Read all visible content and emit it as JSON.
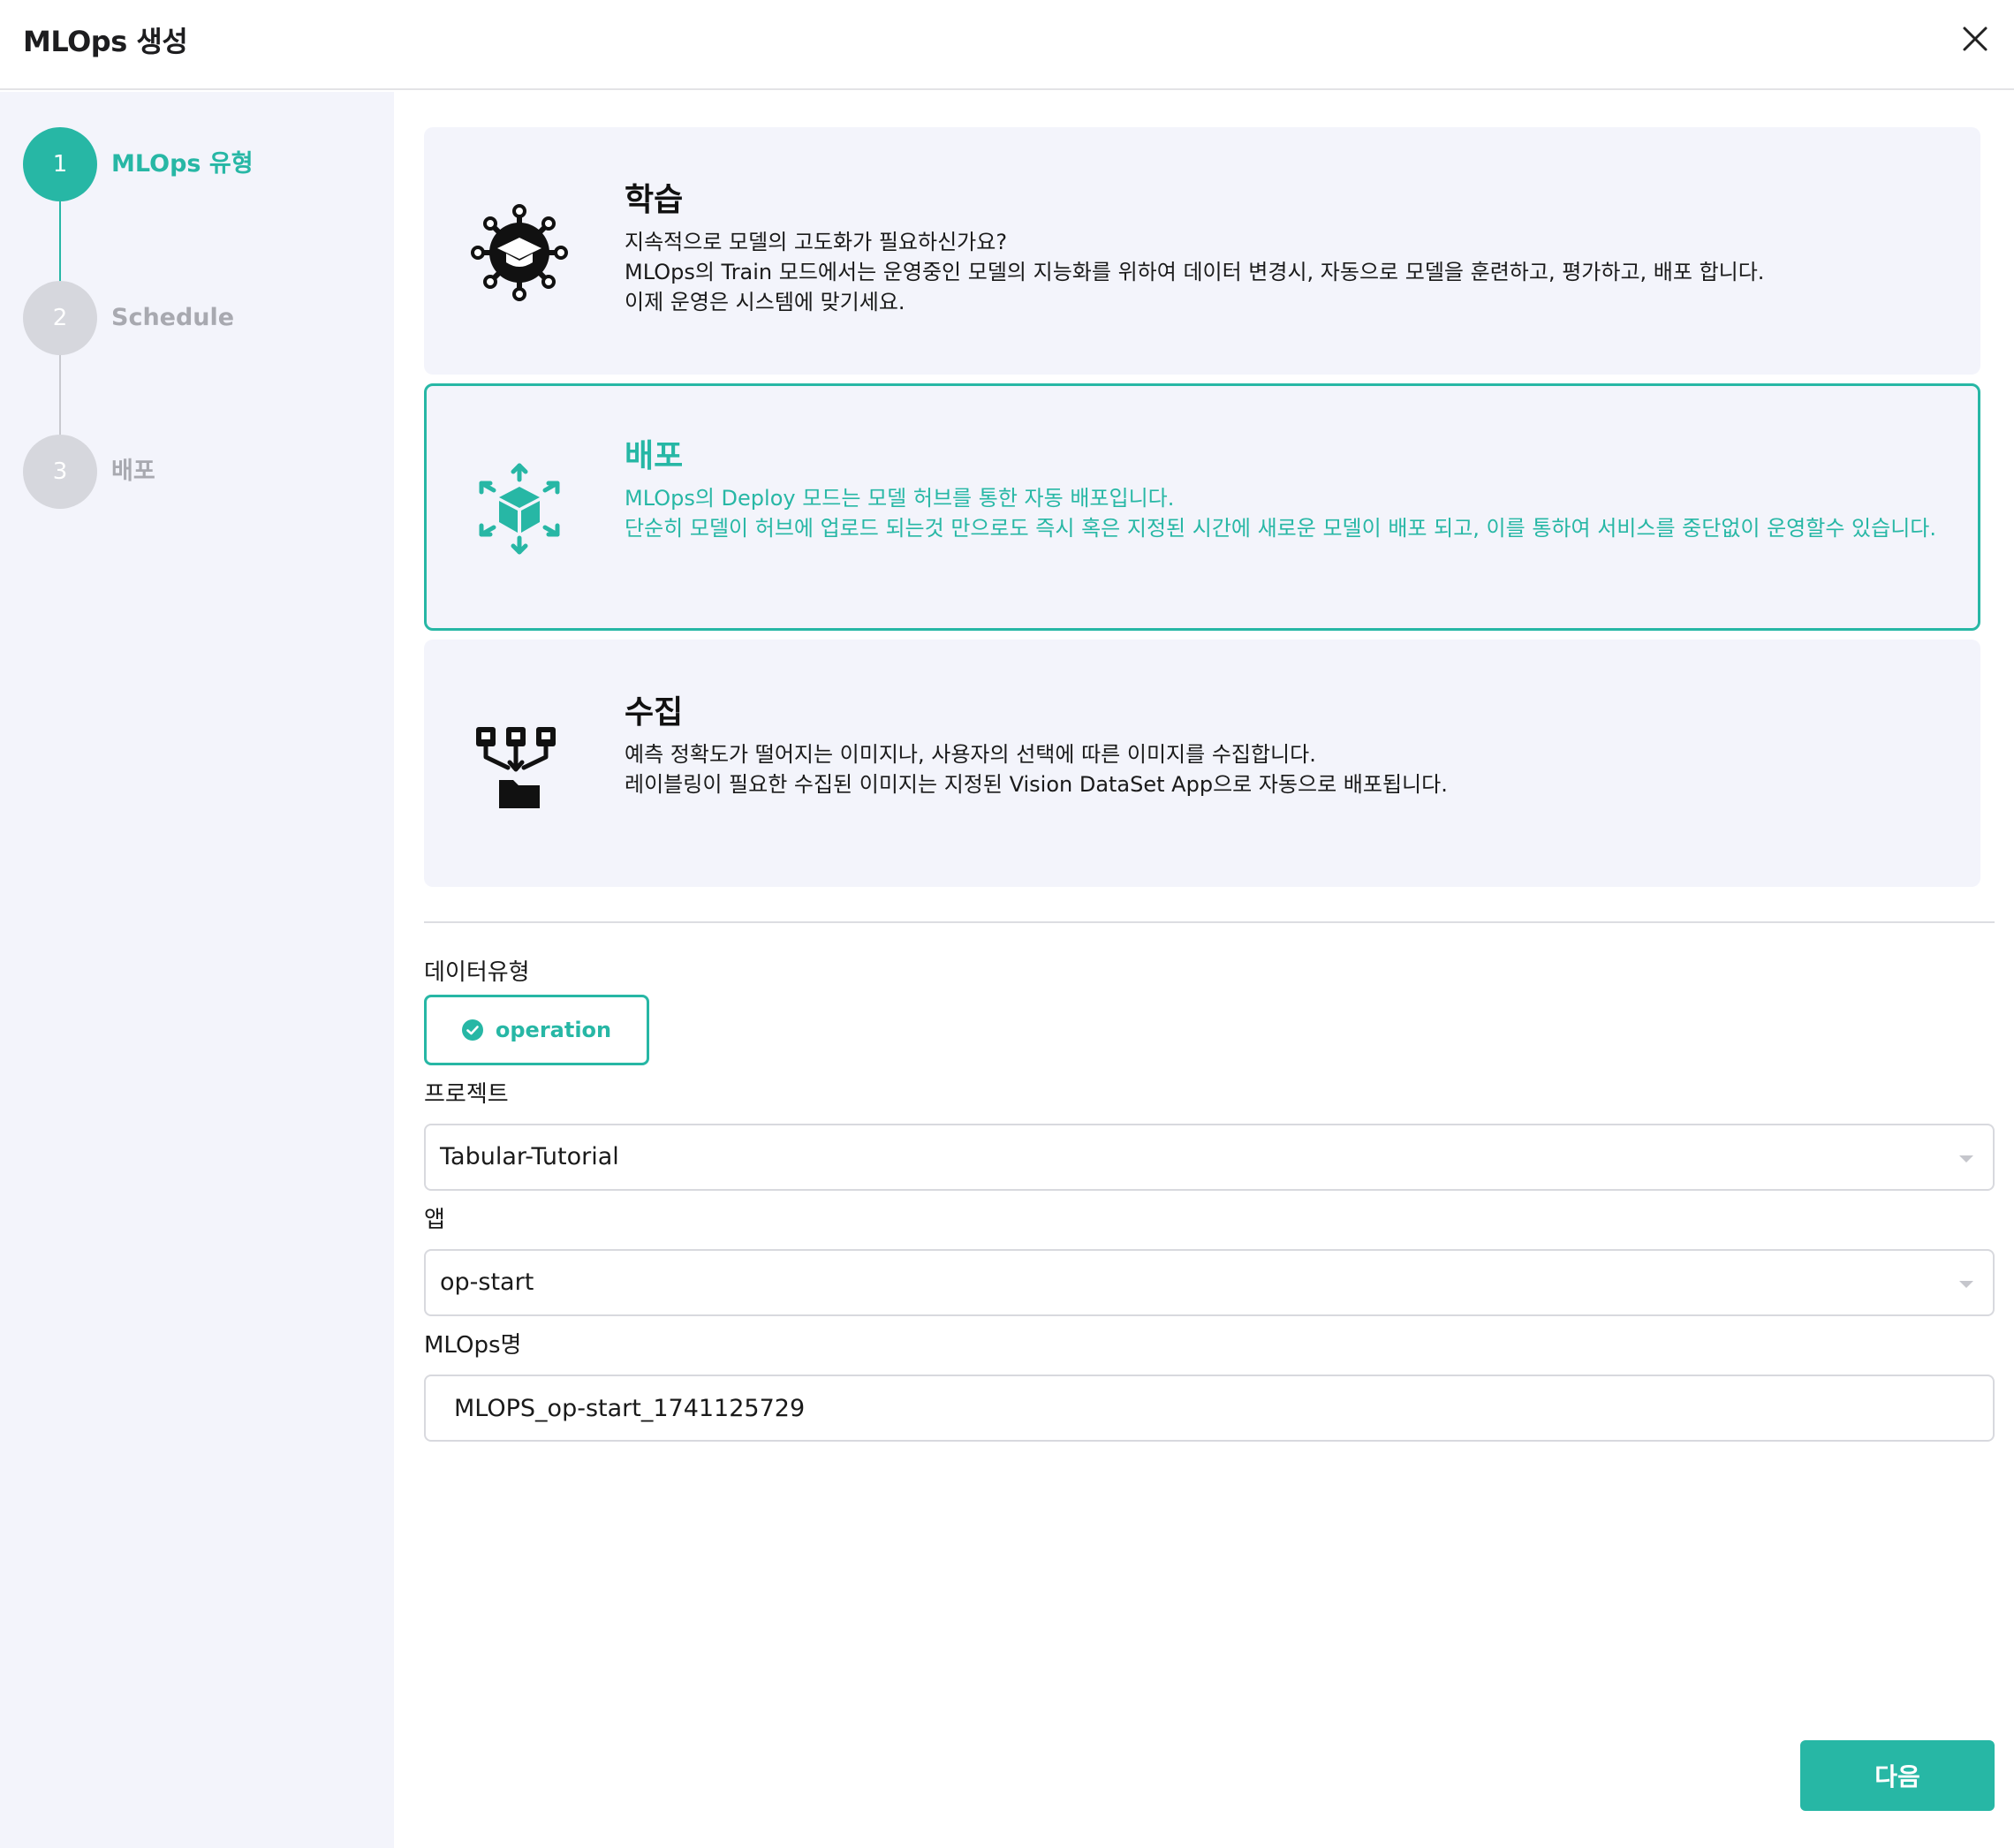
{
  "header": {
    "title": "MLOps 생성",
    "close_icon": "close-icon"
  },
  "steps": [
    {
      "number": "1",
      "label": "MLOps 유형",
      "state": "active"
    },
    {
      "number": "2",
      "label": "Schedule",
      "state": "inactive"
    },
    {
      "number": "3",
      "label": "배포",
      "state": "inactive"
    }
  ],
  "cards": [
    {
      "title": "학습",
      "icon": "graduation-cap-network-icon",
      "lines": [
        "지속적으로 모델의 고도화가 필요하신가요?",
        "MLOps의 Train 모드에서는 운영중인 모델의 지능화를 위하여 데이터 변경시, 자동으로 모델을 훈련하고, 평가하고, 배포 합니다.",
        "이제 운영은 시스템에 맞기세요."
      ],
      "selected": false
    },
    {
      "title": "배포",
      "icon": "cube-deploy-icon",
      "lines": [
        "MLOps의 Deploy 모드는 모델 허브를 통한 자동 배포입니다.",
        "단순히 모델이 허브에 업로드 되는것 만으로도 즉시 혹은 지정된 시간에 새로운 모델이 배포 되고, 이를 통하여 서비스를 중단없이 운영할수 있습니다."
      ],
      "selected": true
    },
    {
      "title": "수집",
      "icon": "collect-folder-icon",
      "lines": [
        "예측 정확도가 떨어지는 이미지나, 사용자의 선택에 따른 이미지를 수집합니다.",
        "레이블링이 필요한 수집된 이미지는 지정된 Vision DataSet App으로 자동으로 배포됩니다."
      ],
      "selected": false
    }
  ],
  "form": {
    "data_type_label": "데이터유형",
    "data_type_value": "operation",
    "project_label": "프로젝트",
    "project_value": "Tabular-Tutorial",
    "app_label": "앱",
    "app_value": "op-start",
    "name_label": "MLOps명",
    "name_value": "MLOPS_op-start_1741125729"
  },
  "footer": {
    "next_label": "다음"
  },
  "colors": {
    "accent": "#27b7a5",
    "panel": "#f3f4fb"
  }
}
